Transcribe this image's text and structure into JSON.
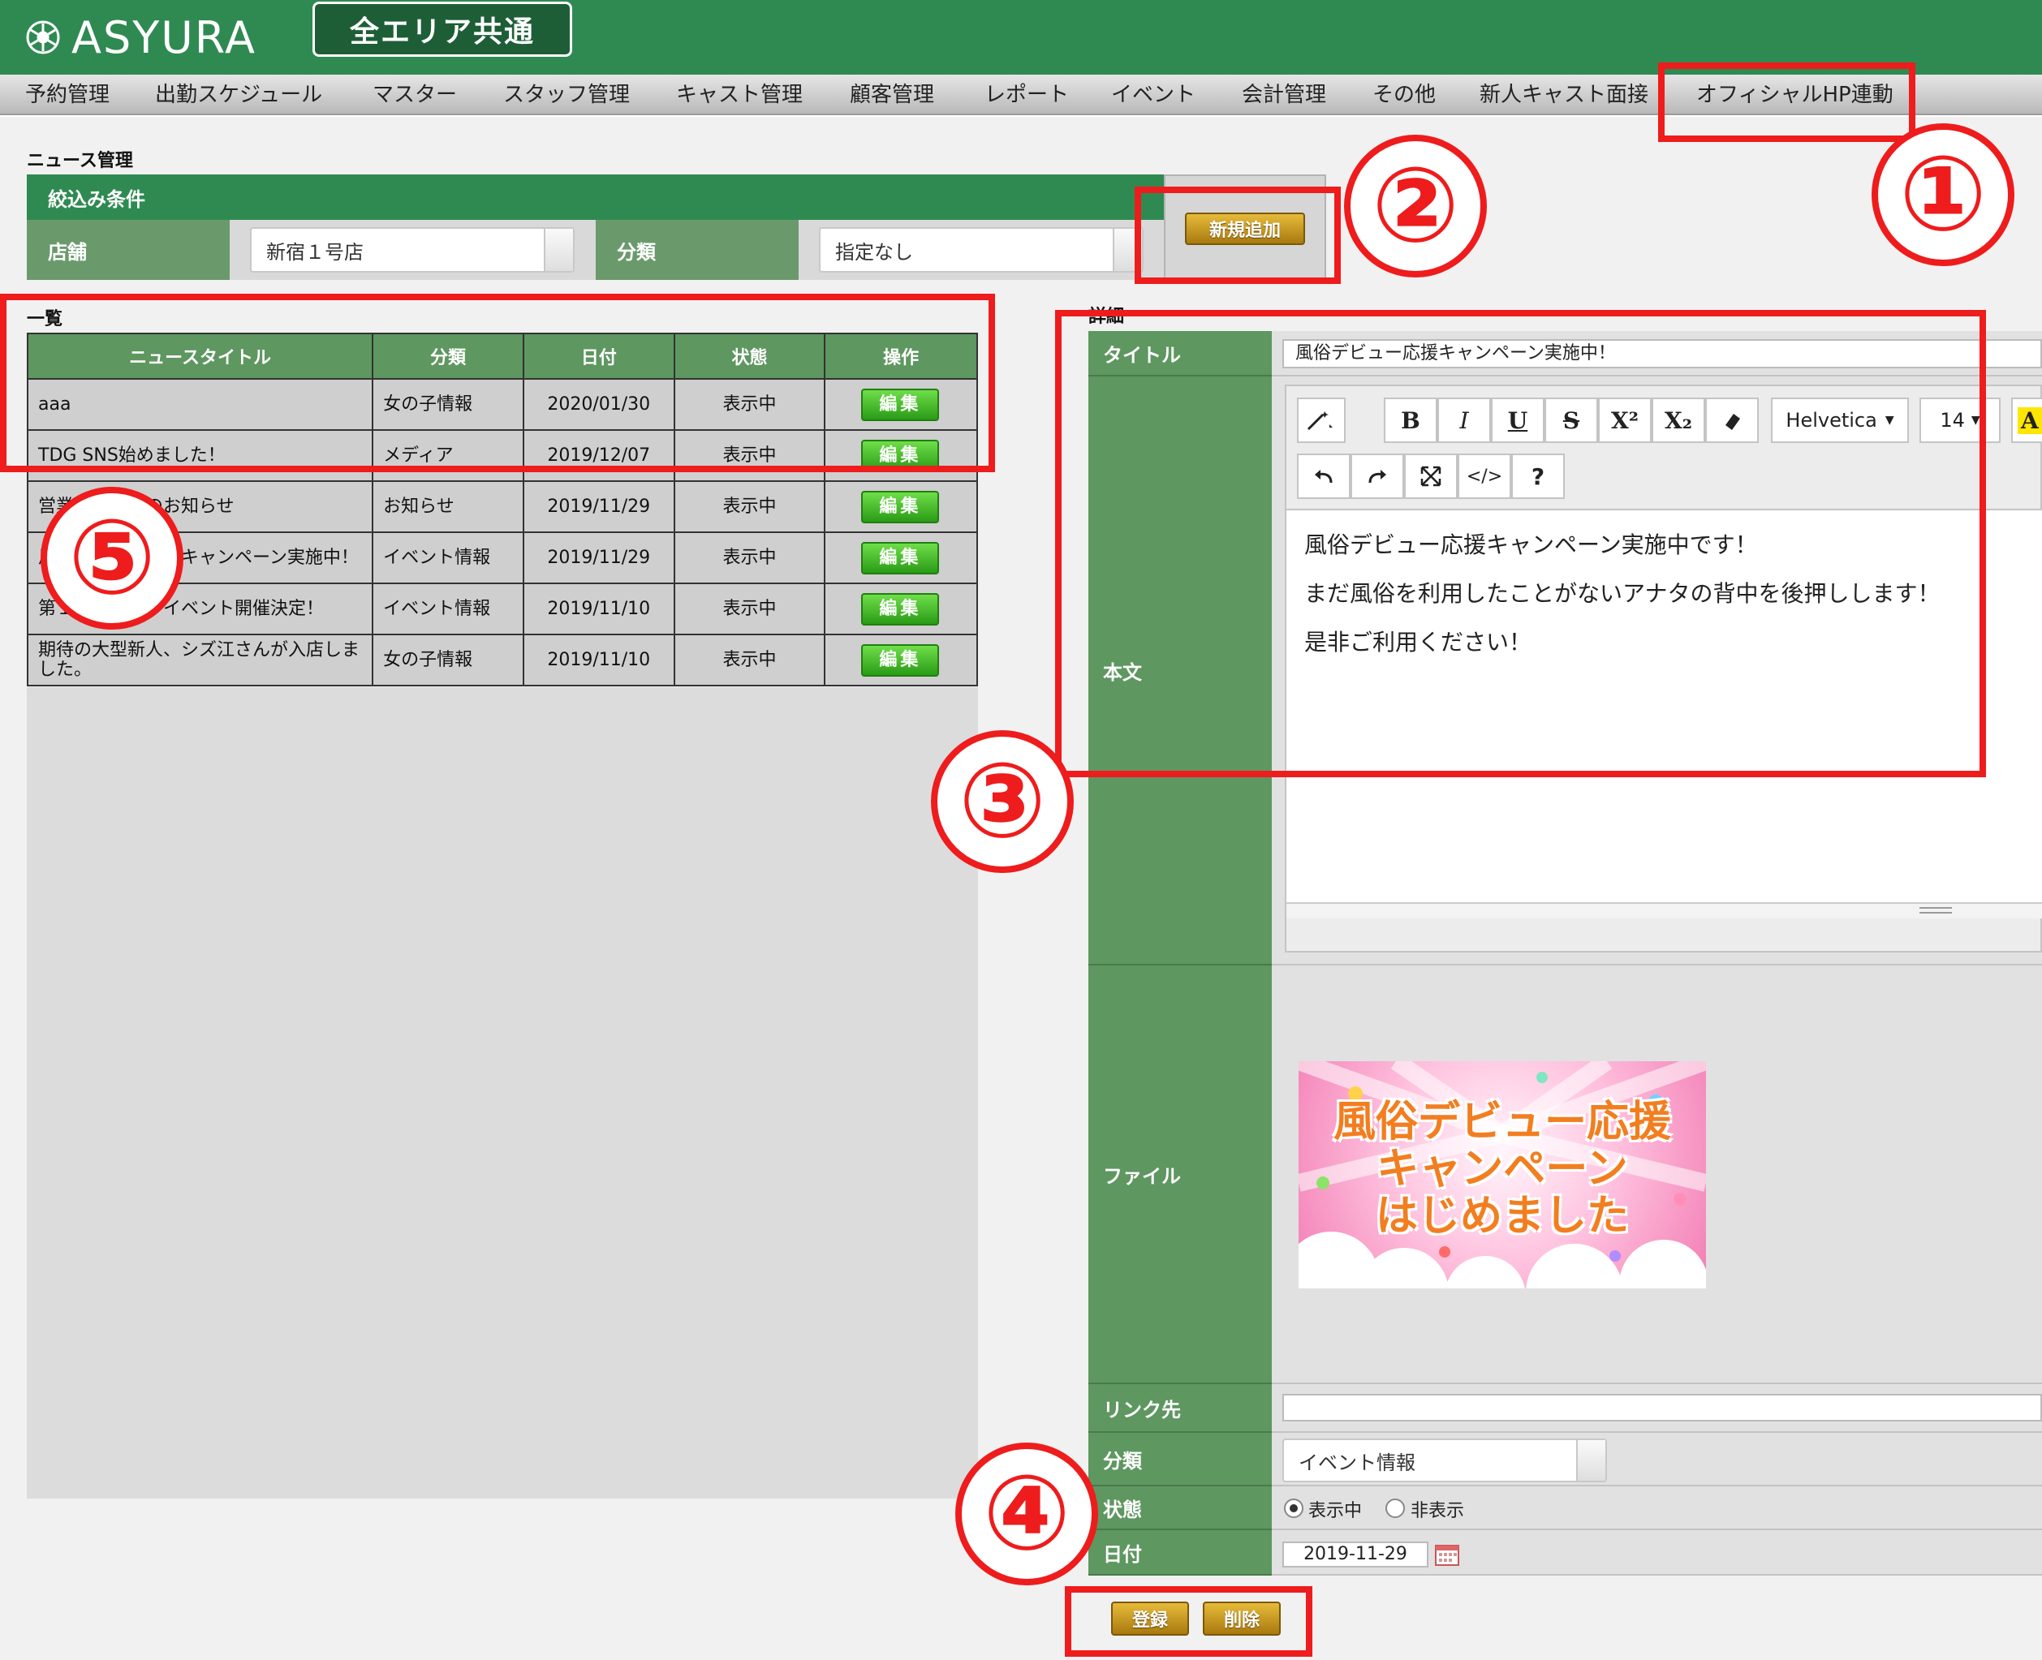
{
  "header": {
    "logo_text": "ASYURA",
    "area_button": "全エリア共通"
  },
  "nav": {
    "items": [
      "予約管理",
      "出勤スケジュール",
      "マスター",
      "スタッフ管理",
      "キャスト管理",
      "顧客管理",
      "レポート",
      "イベント",
      "会計管理",
      "その他",
      "新人キャスト面接",
      "オフィシャルHP連動"
    ]
  },
  "page": {
    "title": "ニュース管理",
    "filter": {
      "heading": "絞込み条件",
      "store_label": "店舗",
      "store_value": "新宿１号店",
      "category_label": "分類",
      "category_value": "指定なし",
      "add_button": "新規追加"
    },
    "list": {
      "heading": "一覧",
      "columns": [
        "ニュースタイトル",
        "分類",
        "日付",
        "状態",
        "操作"
      ],
      "edit_label": "編集",
      "rows": [
        {
          "title": "aaa",
          "category": "女の子情報",
          "date": "2020/01/30",
          "status": "表示中"
        },
        {
          "title": "TDG SNS始めました！",
          "category": "メディア",
          "date": "2019/12/07",
          "status": "表示中"
        },
        {
          "title": "営業時間変更のお知らせ",
          "category": "お知らせ",
          "date": "2019/11/29",
          "status": "表示中"
        },
        {
          "title": "風俗デビュー応援キャンペーン実施中！",
          "category": "イベント情報",
          "date": "2019/11/29",
          "status": "表示中"
        },
        {
          "title": "第１回コスプレイベント開催決定！",
          "category": "イベント情報",
          "date": "2019/11/10",
          "status": "表示中"
        },
        {
          "title": "期待の大型新人、シズ江さんが入店しました。",
          "category": "女の子情報",
          "date": "2019/11/10",
          "status": "表示中"
        }
      ]
    },
    "detail": {
      "heading": "詳細",
      "title_label": "タイトル",
      "title_value": "風俗デビュー応援キャンペーン実施中！",
      "body_label": "本文",
      "toolbar": {
        "bold": "B",
        "italic": "I",
        "underline": "U",
        "strike": "S",
        "superscript": "X²",
        "subscript": "X₂",
        "font_name": "Helvetica",
        "font_size": "14",
        "font_color": "A",
        "code": "</>",
        "help": "?"
      },
      "body_lines": [
        "風俗デビュー応援キャンペーン実施中です！",
        "まだ風俗を利用したことがないアナタの背中を後押しします！",
        "是非ご利用ください！"
      ],
      "file_label": "ファイル",
      "banner_lines": [
        "風俗デビュー応援",
        "キャンペーン",
        "はじめました"
      ],
      "link_label": "リンク先",
      "link_value": "",
      "category_label": "分類",
      "category_value": "イベント情報",
      "status_label": "状態",
      "status_options": [
        "表示中",
        "非表示"
      ],
      "status_selected": "表示中",
      "date_label": "日付",
      "date_value": "2019-11-29",
      "register_button": "登録",
      "delete_button": "削除"
    }
  },
  "annotations": [
    "①",
    "②",
    "③",
    "④",
    "⑤"
  ],
  "colors": {
    "header_green": "#2f8a52",
    "label_green": "#5e9760",
    "annotation_red": "#ee1c1c",
    "gold_button": "#c9981f"
  }
}
